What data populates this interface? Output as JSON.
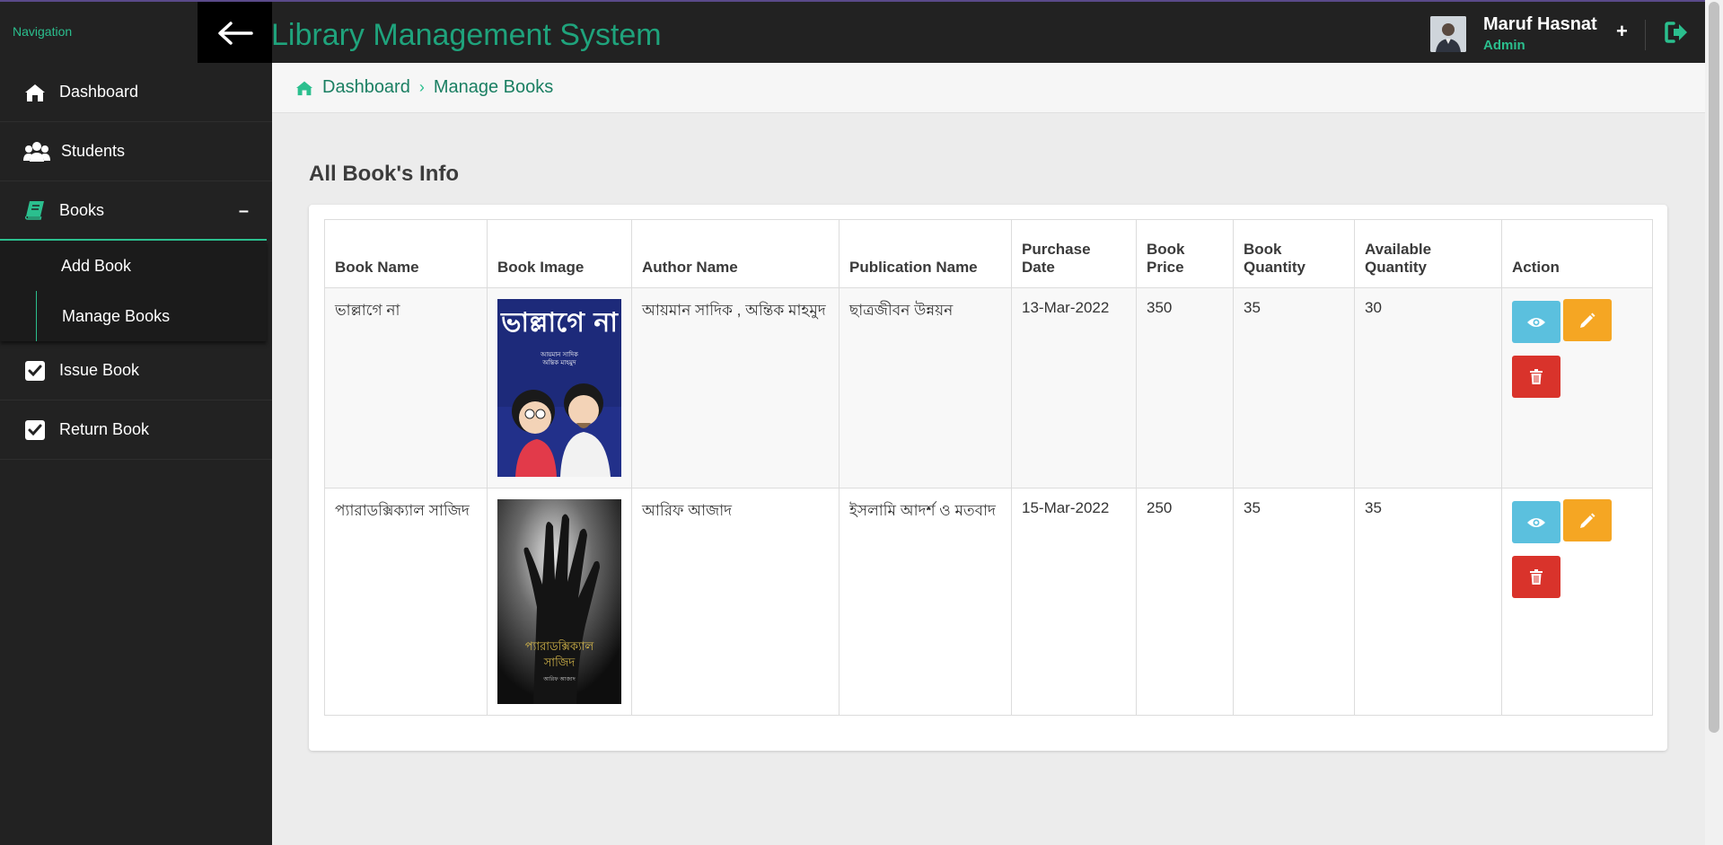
{
  "topbar": {
    "nav_label": "Navigation",
    "title": "Library Management System",
    "user_name": "Maruf Hasnat",
    "user_role": "Admin",
    "plus": "+"
  },
  "sidebar": {
    "items": [
      {
        "label": "Dashboard",
        "icon": "home-icon"
      },
      {
        "label": "Students",
        "icon": "users-icon"
      },
      {
        "label": "Books",
        "icon": "book-icon",
        "toggle": "–"
      },
      {
        "label": "Issue Book",
        "icon": "checkbox-icon"
      },
      {
        "label": "Return Book",
        "icon": "checkbox-icon"
      }
    ],
    "submenu": [
      {
        "label": "Add Book"
      },
      {
        "label": "Manage Books"
      }
    ]
  },
  "breadcrumb": {
    "home": "Dashboard",
    "separator": "›",
    "current": "Manage Books"
  },
  "main": {
    "section_title": "All Book's Info"
  },
  "table": {
    "headers": [
      "Book Name",
      "Book Image",
      "Author Name",
      "Publication Name",
      "Purchase Date",
      "Book Price",
      "Book Quantity",
      "Available Quantity",
      "Action"
    ],
    "rows": [
      {
        "book_name": "ভাল্লাগে না",
        "author": "আয়মান সাদিক , অন্তিক মাহমুদ",
        "publication": "ছাত্রজীবন উন্নয়ন",
        "purchase_date": "13-Mar-2022",
        "price": "350",
        "quantity": "35",
        "available": "30",
        "cover_title": "ভাল্লাগে না",
        "cover_authors": "আয়মান সাদিক",
        "cover_authors2": "অন্তিক মাহমুদ"
      },
      {
        "book_name": "প্যারাডক্সিক্যাল সাজিদ",
        "author": "আরিফ আজাদ",
        "publication": "ইসলামি আদর্শ ও মতবাদ",
        "purchase_date": "15-Mar-2022",
        "price": "250",
        "quantity": "35",
        "available": "35",
        "cover_title": "প্যারাডক্সিক্যাল",
        "cover_title2": "সাজিদ",
        "cover_authors": "আরিফ আজাদ"
      }
    ]
  },
  "colors": {
    "accent": "#2bbf8e",
    "title_green": "#1fa37c",
    "dark_bg": "#222222",
    "view_btn": "#5bc0de",
    "edit_btn": "#f5a623",
    "delete_btn": "#d9332b"
  }
}
